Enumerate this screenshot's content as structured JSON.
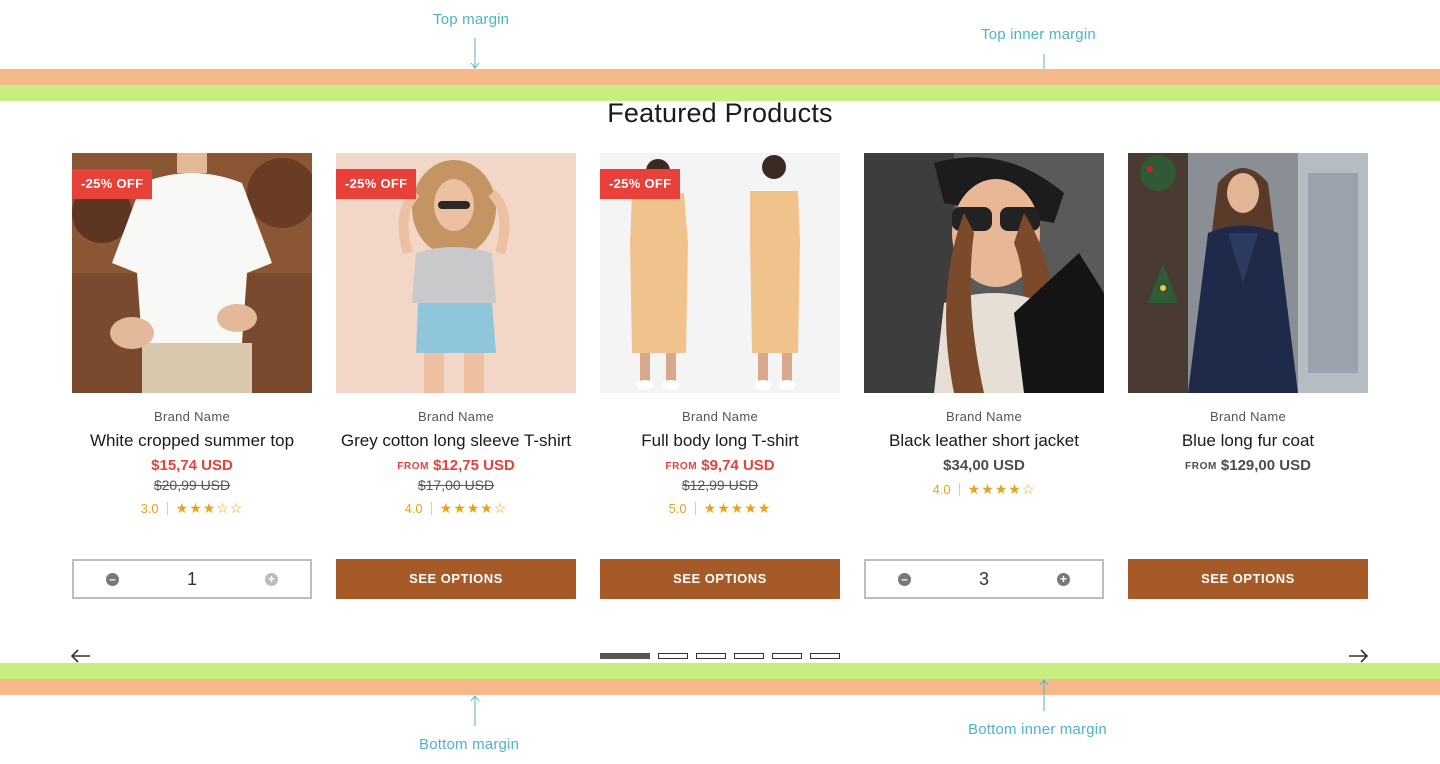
{
  "annotations": {
    "top_margin": "Top margin",
    "top_inner_margin": "Top inner margin",
    "bottom_margin": "Bottom margin",
    "bottom_inner_margin": "Bottom inner margin"
  },
  "colors": {
    "margin_band": "#f6b989",
    "inner_margin_band": "#c6ef7f",
    "sale": "#e8413a",
    "button": "#a65a27",
    "rating": "#e8a31b",
    "annotation": "#4fb3c6"
  },
  "section": {
    "title": "Featured Products"
  },
  "products": [
    {
      "badge": "-25% OFF",
      "brand": "Brand Name",
      "name": "White cropped summer top",
      "from": "",
      "price": "$15,74 USD",
      "compare_price": "$20,99 USD",
      "rating": "3.0",
      "stars": "★★★☆☆",
      "action": {
        "type": "quantity",
        "value": "1",
        "minus_icon": "minus-circle-icon",
        "plus_icon": "plus-circle-icon"
      }
    },
    {
      "badge": "-25% OFF",
      "brand": "Brand Name",
      "name": "Grey cotton long sleeve T-shirt",
      "from": "FROM",
      "price": "$12,75 USD",
      "compare_price": "$17,00 USD",
      "rating": "4.0",
      "stars": "★★★★☆",
      "action": {
        "type": "button",
        "label": "SEE OPTIONS"
      }
    },
    {
      "badge": "-25% OFF",
      "brand": "Brand Name",
      "name": "Full body long T-shirt",
      "from": "FROM",
      "price": "$9,74 USD",
      "compare_price": "$12,99 USD",
      "rating": "5.0",
      "stars": "★★★★★",
      "action": {
        "type": "button",
        "label": "SEE OPTIONS"
      }
    },
    {
      "badge": "",
      "brand": "Brand Name",
      "name": "Black leather short jacket",
      "from": "",
      "price": "$34,00 USD",
      "compare_price": "",
      "rating": "4.0",
      "stars": "★★★★☆",
      "action": {
        "type": "quantity",
        "value": "3",
        "minus_icon": "minus-circle-icon",
        "plus_icon": "plus-circle-icon"
      }
    },
    {
      "badge": "",
      "brand": "Brand Name",
      "name": "Blue long fur coat",
      "from": "FROM",
      "price": "$129,00 USD",
      "compare_price": "",
      "rating": "",
      "stars": "",
      "action": {
        "type": "button",
        "label": "SEE OPTIONS"
      }
    }
  ],
  "carousel": {
    "prev_icon": "arrow-left-icon",
    "next_icon": "arrow-right-icon",
    "page_count": 6,
    "active_page": 1
  }
}
